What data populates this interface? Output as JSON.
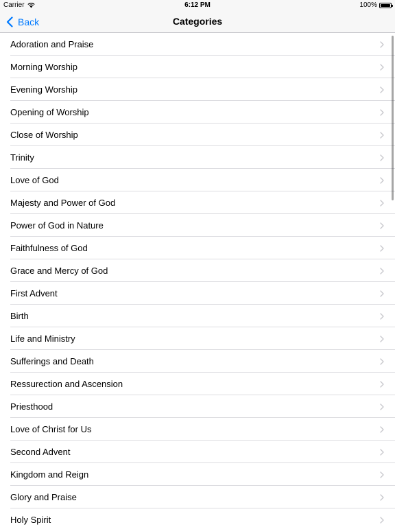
{
  "status_bar": {
    "carrier": "Carrier",
    "time": "6:12 PM",
    "battery_percent": "100%",
    "battery_level": 1.0
  },
  "nav": {
    "back_label": "Back",
    "title": "Categories"
  },
  "colors": {
    "accent": "#007aff",
    "separator": "#dcdce0",
    "bar_background": "#f7f7f7"
  },
  "categories": [
    {
      "label": "Adoration and Praise"
    },
    {
      "label": "Morning Worship"
    },
    {
      "label": "Evening Worship"
    },
    {
      "label": "Opening of Worship"
    },
    {
      "label": "Close of Worship"
    },
    {
      "label": "Trinity"
    },
    {
      "label": "Love of God"
    },
    {
      "label": "Majesty and Power of God"
    },
    {
      "label": "Power of God in Nature"
    },
    {
      "label": "Faithfulness of God"
    },
    {
      "label": "Grace and Mercy of God"
    },
    {
      "label": "First Advent"
    },
    {
      "label": "Birth"
    },
    {
      "label": "Life and Ministry"
    },
    {
      "label": "Sufferings and Death"
    },
    {
      "label": "Ressurection and Ascension"
    },
    {
      "label": "Priesthood"
    },
    {
      "label": "Love of Christ for Us"
    },
    {
      "label": "Second Advent"
    },
    {
      "label": "Kingdom and Reign"
    },
    {
      "label": "Glory and Praise"
    },
    {
      "label": "Holy Spirit"
    }
  ]
}
